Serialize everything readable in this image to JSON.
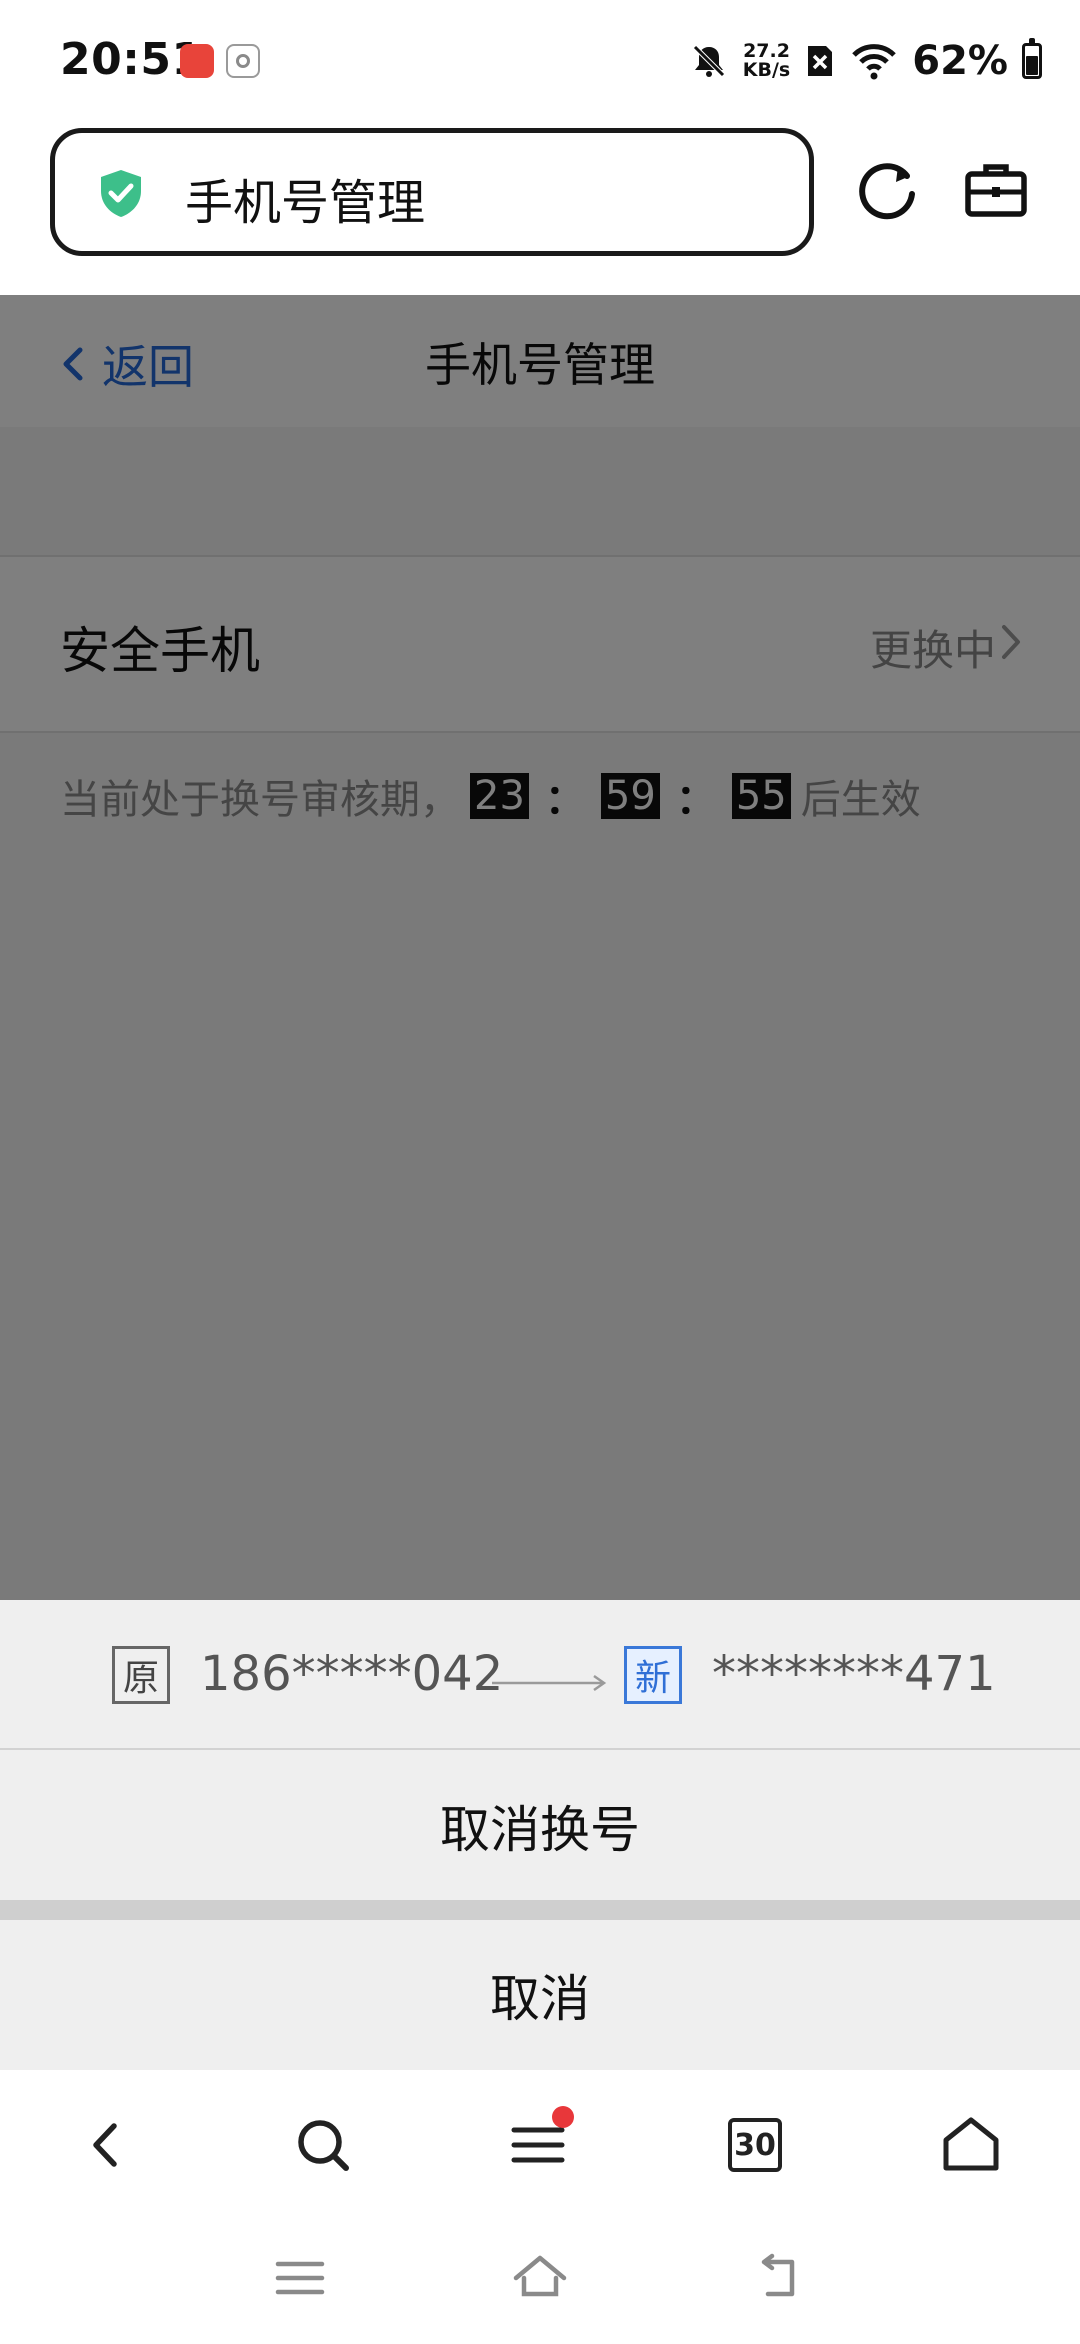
{
  "status_bar": {
    "time": "20:51",
    "net_speed_value": "27.2",
    "net_speed_unit": "KB/s",
    "battery_percent": "62%",
    "battery_level": 0.62,
    "icons": [
      "huawei-app-icon",
      "settings-app-icon",
      "mute-bell-icon",
      "no-sim-icon",
      "wifi-icon",
      "battery-icon"
    ]
  },
  "browser": {
    "url_title": "手机号管理",
    "icons": [
      "shield-check-icon",
      "reload-icon",
      "toolbox-icon"
    ],
    "accent": "#3dbf8a"
  },
  "page": {
    "back_label": "返回",
    "title": "手机号管理",
    "row_label": "安全手机",
    "row_status": "更换中",
    "notice_prefix": "当前处于换号审核期，",
    "countdown": {
      "hours": "23",
      "minutes": "59",
      "seconds": "55",
      "separator": "："
    },
    "notice_suffix": "后生效",
    "link_color": "#2468d6"
  },
  "sheet": {
    "old_tag": "原",
    "old_number": "186*****042",
    "new_tag": "新",
    "new_number": "********471",
    "cancel_change_label": "取消换号",
    "cancel_label": "取消"
  },
  "toolbar": {
    "tabs_count": "30",
    "icons": [
      "back-icon",
      "search-icon",
      "menu-icon",
      "tabs-icon",
      "home-icon"
    ],
    "notification_color": "#e8373a"
  },
  "system_nav": {
    "icons": [
      "recent-apps-icon",
      "home-icon",
      "back-icon"
    ]
  }
}
